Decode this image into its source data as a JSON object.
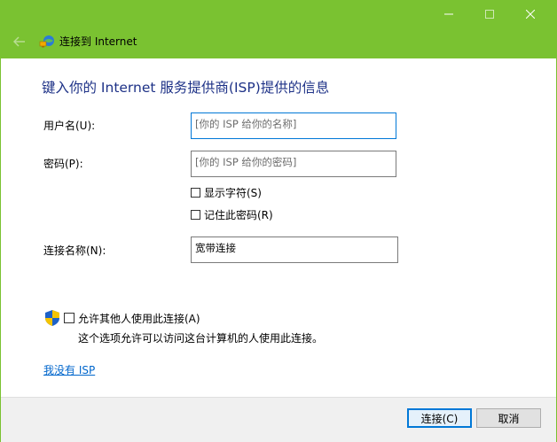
{
  "window": {
    "title": "连接到 Internet",
    "accent": "#7ac231",
    "controls": {
      "minimize": "minimize-icon",
      "maximize": "maximize-icon",
      "close": "close-icon"
    }
  },
  "heading": "键入你的 Internet 服务提供商(ISP)提供的信息",
  "form": {
    "username": {
      "label": "用户名(U):",
      "placeholder": "[你的 ISP 给你的名称]"
    },
    "password": {
      "label": "密码(P):",
      "placeholder": "[你的 ISP 给你的密码]"
    },
    "show_chars": {
      "label": "显示字符(S)",
      "checked": false
    },
    "remember_pw": {
      "label": "记住此密码(R)",
      "checked": false
    },
    "connection_name": {
      "label": "连接名称(N):",
      "value": "宽带连接"
    }
  },
  "allow_others": {
    "label": "允许其他人使用此连接(A)",
    "checked": false,
    "description": "这个选项允许可以访问这台计算机的人使用此连接。",
    "icon": "uac-shield-icon"
  },
  "no_isp_link": "我没有 ISP",
  "buttons": {
    "connect": "连接(C)",
    "cancel": "取消"
  }
}
